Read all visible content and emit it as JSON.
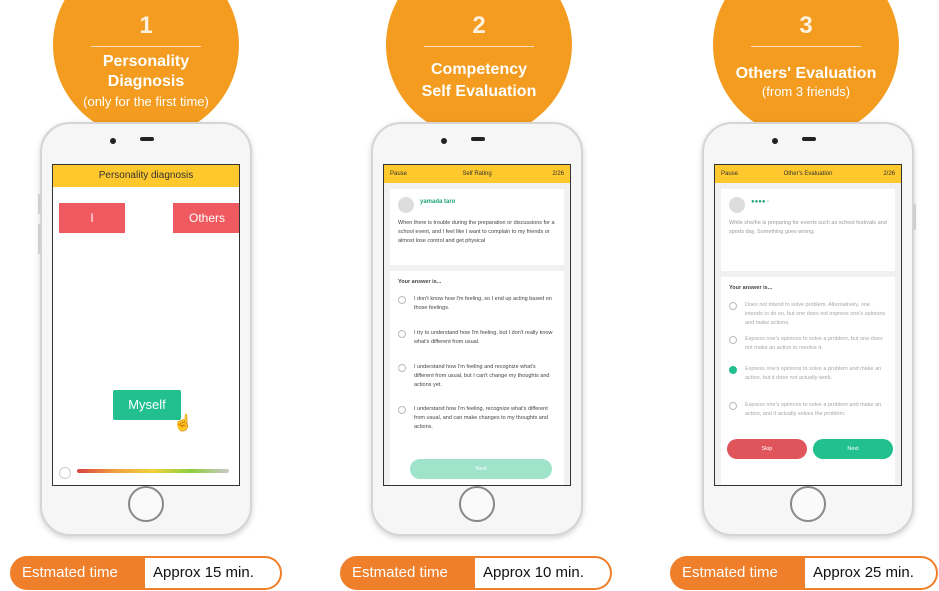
{
  "steps": [
    {
      "number": "1",
      "title_lines": [
        "Personality",
        "Diagnosis"
      ],
      "subtitle": "(only for the first time)",
      "screen": {
        "header": "Personality diagnosis",
        "btn_i": "I",
        "btn_others": "Others",
        "btn_myself": "Myself"
      },
      "estimate_label": "Estmated time",
      "estimate_value": "Approx 15 min."
    },
    {
      "number": "2",
      "title_lines": [
        "Competency",
        "Self Evaluation"
      ],
      "subtitle": "",
      "screen": {
        "pause": "Pause",
        "header": "Self Rating",
        "progress": "2/26",
        "user": "yamada taro",
        "question": "When there is trouble during the preparation or discussions for a school event, and I feel like I want to complain to my friends or almost lose control and get physical",
        "answer_heading": "Your answer is...",
        "options": [
          "I don't know how I'm feeling, so I end up acting based on those feelings.",
          "I try to understand how I'm feeling, but I don't really know what's different from usual.",
          "I understand how I'm feeling and recognize what's different from usual, but I can't change my thoughts and actions yet.",
          "I understand how I'm feeling, recognize what's different from usual, and can make changes to my thoughts and actions."
        ],
        "next": "Next"
      },
      "estimate_label": "Estmated time",
      "estimate_value": "Approx 10 min."
    },
    {
      "number": "3",
      "title_lines": [
        "Others' Evaluation"
      ],
      "subtitle": "(from 3 friends)",
      "screen": {
        "pause": "Pause",
        "header": "Other's Evaluation",
        "progress": "2/26",
        "user": "●●●● ·",
        "question": "While she/he is preparing for events such as school festivals and sports day, Something goes wrong.",
        "answer_heading": "Your answer is...",
        "options": [
          "Does not intend to solve problem. Alternatively, one intends to do so, but one does not express one's opinions and make actions.",
          "Express one's opinions to solve a problem, but one does not make an action to resolve it.",
          "Express one's opinions to solve a problem and make an action, but it does not actually work.",
          "Express one's opinions to solve a problem and make an action, and it actually solves the problem."
        ],
        "skip": "Skip",
        "next": "Next"
      },
      "estimate_label": "Estmated time",
      "estimate_value": "Approx 25 min."
    }
  ],
  "colors": {
    "orange": "#f39c1f",
    "yellow_bar": "#ffc82c",
    "red_button": "#ee5a5f",
    "green": "#22c08e"
  }
}
